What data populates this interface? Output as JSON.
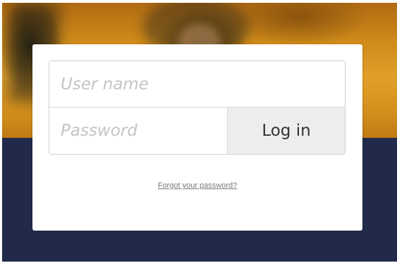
{
  "login": {
    "username_placeholder": "User name",
    "username_value": "",
    "password_placeholder": "Password",
    "password_value": "",
    "login_label": "Log in",
    "forgot_label": "Forgot your password?"
  },
  "colors": {
    "background_dark": "#212a4a",
    "hero_gold": "#d08c1a",
    "card": "#ffffff",
    "button": "#ededed",
    "placeholder_text": "#c4c4c4"
  }
}
